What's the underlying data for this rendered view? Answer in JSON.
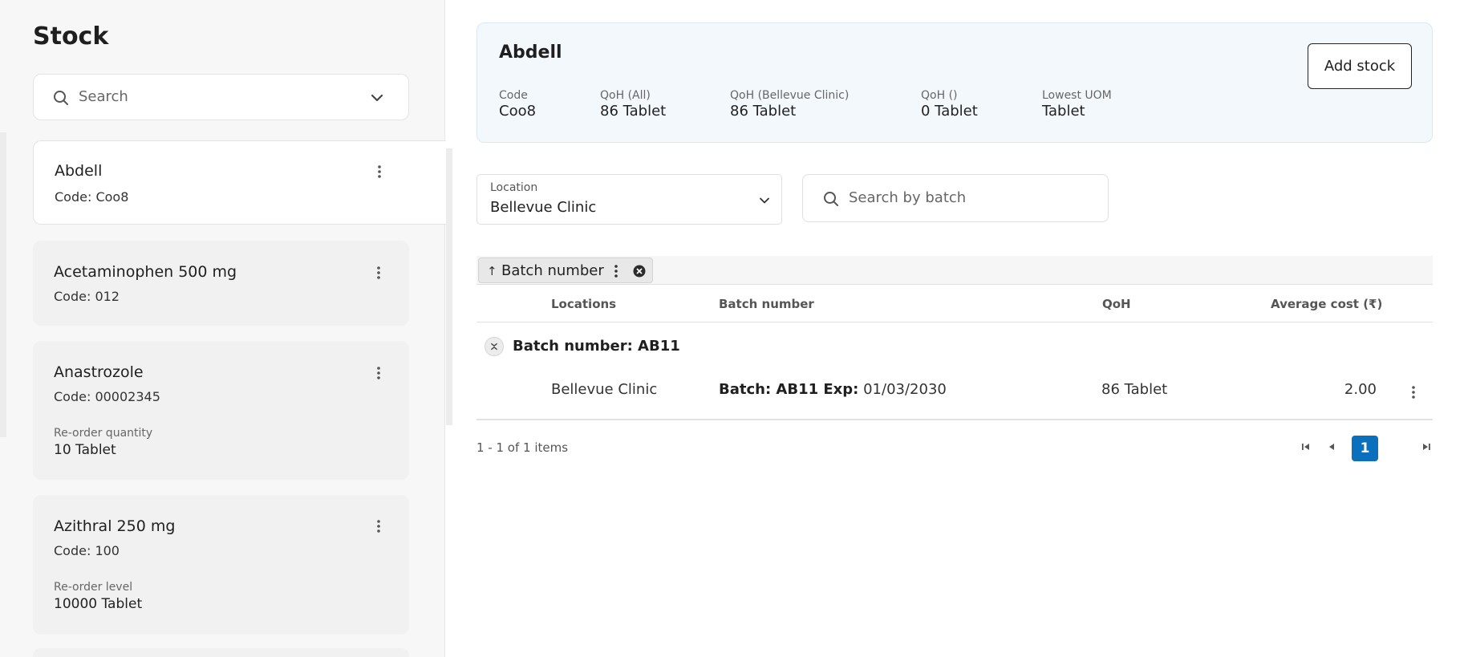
{
  "sidebar": {
    "title": "Stock",
    "search_placeholder": "Search",
    "items": [
      {
        "name": "Abdell",
        "code": "Code: Coo8"
      },
      {
        "name": "Acetaminophen 500 mg",
        "code": "Code: 012"
      },
      {
        "name": "Anastrozole",
        "code": "Code: 00002345",
        "sub_label": "Re-order quantity",
        "sub_value": "10 Tablet"
      },
      {
        "name": "Azithral 250 mg",
        "code": "Code: 100",
        "sub_label": "Re-order level",
        "sub_value": "10000 Tablet"
      }
    ]
  },
  "header": {
    "title": "Abdell",
    "add_stock_label": "Add stock",
    "stats": [
      {
        "label": "Code",
        "value": "Coo8"
      },
      {
        "label": "QoH (All)",
        "value": "86 Tablet"
      },
      {
        "label": "QoH (Bellevue Clinic)",
        "value": "86 Tablet"
      },
      {
        "label": "QoH ()",
        "value": "0 Tablet"
      },
      {
        "label": "Lowest UOM",
        "value": "Tablet"
      }
    ]
  },
  "filters": {
    "location_label": "Location",
    "location_value": "Bellevue Clinic",
    "batch_search_placeholder": "Search by batch"
  },
  "grouping": {
    "chip_label": "Batch number",
    "chip_arrow": "↑"
  },
  "table": {
    "columns": [
      "Locations",
      "Batch number",
      "QoH",
      "Average cost (₹)"
    ],
    "group_label": "Batch number: AB11",
    "rows": [
      {
        "location": "Bellevue Clinic",
        "batch_bold": "Batch: AB11 Exp:",
        "batch_rest": "01/03/2030",
        "qoh": "86 Tablet",
        "avg_cost": "2.00"
      }
    ]
  },
  "pagination": {
    "info": "1 - 1 of 1 items",
    "current_page": "1"
  },
  "colors": {
    "accent": "#0a6fbd",
    "header_bg": "#f3f8fd",
    "sidebar_bg": "#f7f7f7"
  }
}
